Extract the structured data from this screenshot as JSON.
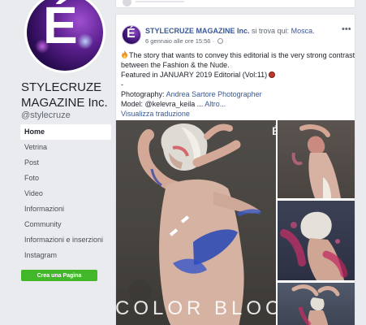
{
  "sidebar": {
    "avatar_letter": "É",
    "page_name": "STYLECRUZE MAGAZINE Inc.",
    "handle": "@stylecruze",
    "nav": [
      {
        "label": "Home",
        "active": true
      },
      {
        "label": "Vetrina"
      },
      {
        "label": "Post"
      },
      {
        "label": "Foto"
      },
      {
        "label": "Video"
      },
      {
        "label": "Informazioni"
      },
      {
        "label": "Community"
      },
      {
        "label": "Informazioni e inserzioni"
      },
      {
        "label": "Instagram"
      }
    ],
    "create_page_label": "Crea una Pagina"
  },
  "post": {
    "avatar_letter": "É",
    "author": "STYLECRUZE MAGAZINE Inc.",
    "location_prefix": "si trova qui:",
    "location": "Mosca",
    "location_suffix": ".",
    "timestamp": "6 gennaio alle ore 15:56",
    "more_label": "•••",
    "line1": "The story that wants to convey this editorial is the very strong contrast",
    "line2": "between the Fashion & the Nude.",
    "line3": "Featured in JANUARY 2019 Editorial (Vol:11)",
    "line4": "-",
    "photography_label": "Photography:",
    "photographer": "Andrea Sartore Photographer",
    "model_label": "Model:",
    "model_handle": "@kelevra_keila",
    "ellipsis": "...",
    "more_link": "Altro...",
    "translate_link": "Visualizza traduzione",
    "image_overlay_text": "COLOR BLOCK",
    "image_overlay_corner": "É"
  },
  "colors": {
    "link": "#385898",
    "page_bg": "#e9ebee",
    "create_button": "#42b72a"
  }
}
